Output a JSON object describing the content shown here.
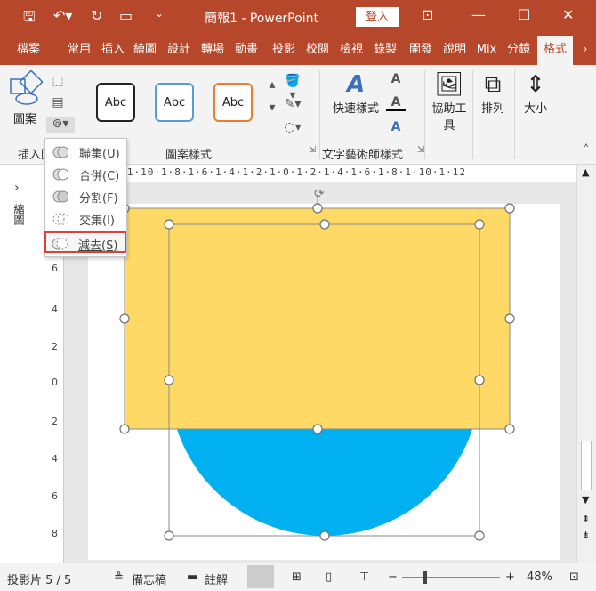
{
  "title_bar": {
    "doc_title": "簡報1 - PowerPoint",
    "login": "登入"
  },
  "tabs": [
    "檔案",
    "常用",
    "插入",
    "繪圖",
    "設計",
    "轉場",
    "動畫",
    "投影",
    "校閱",
    "檢視",
    "錄製",
    "開發",
    "說明",
    "Mix",
    "分鏡",
    "格式"
  ],
  "ribbon": {
    "insert_shapes": {
      "shapes_label": "圖案",
      "group_label": "插入圖"
    },
    "shape_styles": {
      "samples": [
        "Abc",
        "Abc",
        "Abc"
      ],
      "group_label": "圖案樣式"
    },
    "wordart": {
      "quick_styles": "快速樣式",
      "group_label": "文字藝術師樣式",
      "a_letters": [
        "A",
        "A",
        "A"
      ]
    },
    "accessibility": {
      "label_line1": "協助工",
      "label_line2": "具"
    },
    "arrange": {
      "label": "排列"
    },
    "size": {
      "label": "大小"
    }
  },
  "merge_menu": [
    {
      "label": "聯集(U)",
      "icon": "union-icon"
    },
    {
      "label": "合併(C)",
      "icon": "combine-icon"
    },
    {
      "label": "分割(F)",
      "icon": "fragment-icon"
    },
    {
      "label": "交集(I)",
      "icon": "intersect-icon"
    },
    {
      "label": "減去(S)",
      "icon": "subtract-icon",
      "highlighted": true
    }
  ],
  "side_panel": {
    "label": "縮圖"
  },
  "rulers": {
    "h": "12·1·10·1·8·1·6·1·4·1·2·1·0·1·2·1·4·1·6·1·8·1·10·1·12",
    "v": [
      "6",
      "4",
      "2",
      "0",
      "2",
      "4",
      "6",
      "8"
    ]
  },
  "colors": {
    "accent": "#b7472a",
    "rect": "#ffd966",
    "circle": "#00b0f0",
    "highlight": "#e0403d"
  },
  "status": {
    "slide": "投影片 5 / 5",
    "notes": "備忘稿",
    "comments": "註解",
    "zoom": "48%"
  }
}
